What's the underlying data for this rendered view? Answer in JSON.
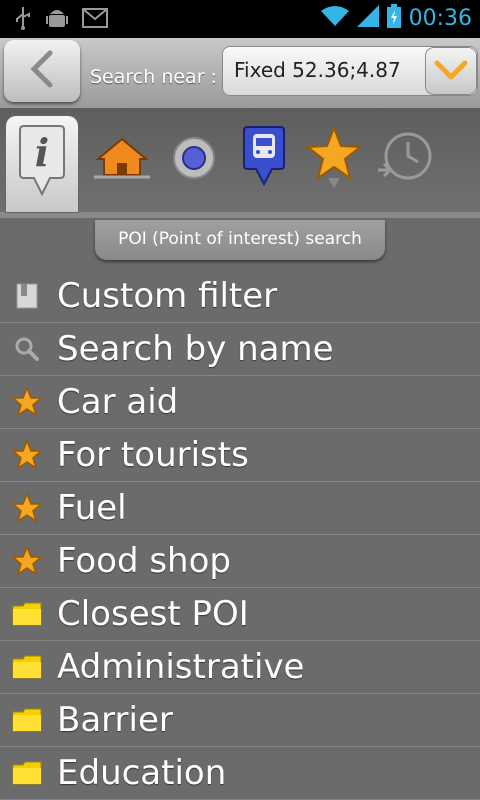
{
  "status_bar": {
    "time": "00:36"
  },
  "header": {
    "back_label": "Back",
    "search_label": "Search near :",
    "near_value": "Fixed 52.36;4.87"
  },
  "tabs": [
    {
      "name": "info-tab",
      "icon": "info-icon",
      "active": true
    },
    {
      "name": "home-tab",
      "icon": "home-icon"
    },
    {
      "name": "position-tab",
      "icon": "position-dot-icon"
    },
    {
      "name": "transport-tab",
      "icon": "train-icon"
    },
    {
      "name": "favorites-tab",
      "icon": "star-icon"
    },
    {
      "name": "history-tab",
      "icon": "clock-icon"
    }
  ],
  "caption": "POI (Point of interest) search",
  "list": [
    {
      "label": "Custom filter",
      "icon": "filter-icon"
    },
    {
      "label": "Search by name",
      "icon": "search-icon"
    },
    {
      "label": "Car aid",
      "icon": "star-icon"
    },
    {
      "label": "For tourists",
      "icon": "star-icon"
    },
    {
      "label": "Fuel",
      "icon": "star-icon"
    },
    {
      "label": "Food shop",
      "icon": "star-icon"
    },
    {
      "label": "Closest POI",
      "icon": "folder-icon"
    },
    {
      "label": "Administrative",
      "icon": "folder-icon"
    },
    {
      "label": "Barrier",
      "icon": "folder-icon"
    },
    {
      "label": "Education",
      "icon": "folder-icon"
    }
  ],
  "colors": {
    "accent": "#33b5e5",
    "star": "#f5a623",
    "folder": "#f5d000"
  }
}
